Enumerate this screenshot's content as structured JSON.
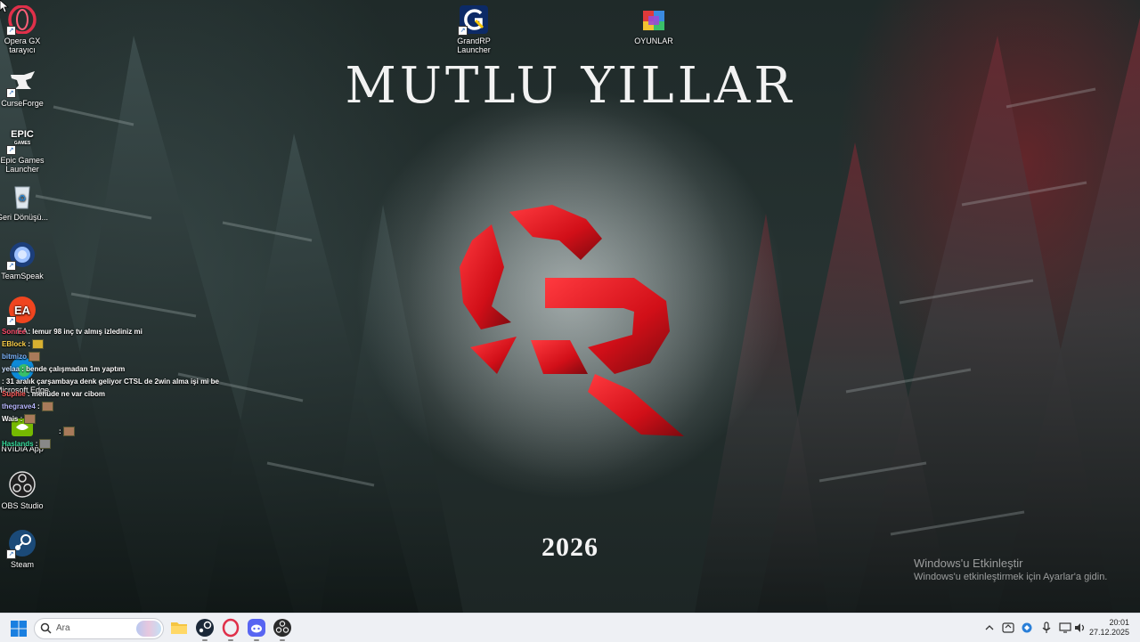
{
  "wallpaper": {
    "title": "MUTLU YILLAR",
    "year": "2026",
    "logo_color": "#e0141c"
  },
  "watermark": {
    "line1": "Windows'u Etkinleştir",
    "line2": "Windows'u etkinleştirmek için Ayarlar'a gidin."
  },
  "desktop": {
    "icons": [
      {
        "name": "opera-gx-icon",
        "label": "Opera GX tarayıcı"
      },
      {
        "name": "curseforge-icon",
        "label": "CurseForge"
      },
      {
        "name": "epic-games-icon",
        "label": "Epic Games Launcher"
      },
      {
        "name": "recycle-bin-icon",
        "label": "Geri Dönüşü..."
      },
      {
        "name": "teamspeak-icon",
        "label": "TeamSpeak"
      },
      {
        "name": "ea-icon",
        "label": "EA"
      },
      {
        "name": "edge-icon",
        "label": "Microsoft Edge"
      },
      {
        "name": "nvidia-icon",
        "label": "NVIDIA App"
      },
      {
        "name": "obs-icon",
        "label": "OBS Studio"
      },
      {
        "name": "steam-icon",
        "label": "Steam"
      },
      {
        "name": "grandrp-launcher-icon",
        "label": "GrandRP Launcher"
      },
      {
        "name": "oyunlar-folder-icon",
        "label": "OYUNLAR"
      }
    ]
  },
  "chat": {
    "messages": [
      {
        "user": "Sonree",
        "text": " : lemur 98 inç tv almış izlediniz mi",
        "color": "#ff4d6d"
      },
      {
        "user": "EBlock",
        "text": " :",
        "color": "#ffd24a"
      },
      {
        "user": "bitmizo",
        "text": "",
        "color": "#7fb6ff"
      },
      {
        "user": "yelaa",
        "text": " : bende çalışmadan 1m yaptım",
        "color": "#cfe3ff"
      },
      {
        "user": "",
        "text": " : 31 aralık çarşambaya denk geliyor CTSL de 2win alma işi mi be",
        "color": "#ff6a6a"
      },
      {
        "user": "Suphie",
        "text": " : menüde ne var cibom",
        "color": "#ff5c5c"
      },
      {
        "user": "thegrave4",
        "text": " :",
        "color": "#b8b8ff"
      },
      {
        "user": "Wais",
        "text": " :",
        "color": "#ffffff"
      },
      {
        "user": "",
        "text": " :",
        "color": "#ff5c8a"
      },
      {
        "user": "Haslands",
        "text": " :",
        "color": "#38e0a0"
      }
    ]
  },
  "taskbar": {
    "search_placeholder": "Ara",
    "apps": [
      "file-explorer-icon",
      "steam-taskbar-icon",
      "opera-gx-taskbar-icon",
      "discord-icon",
      "obs-taskbar-icon"
    ],
    "time": "20:01",
    "date": "27.12.2025"
  }
}
